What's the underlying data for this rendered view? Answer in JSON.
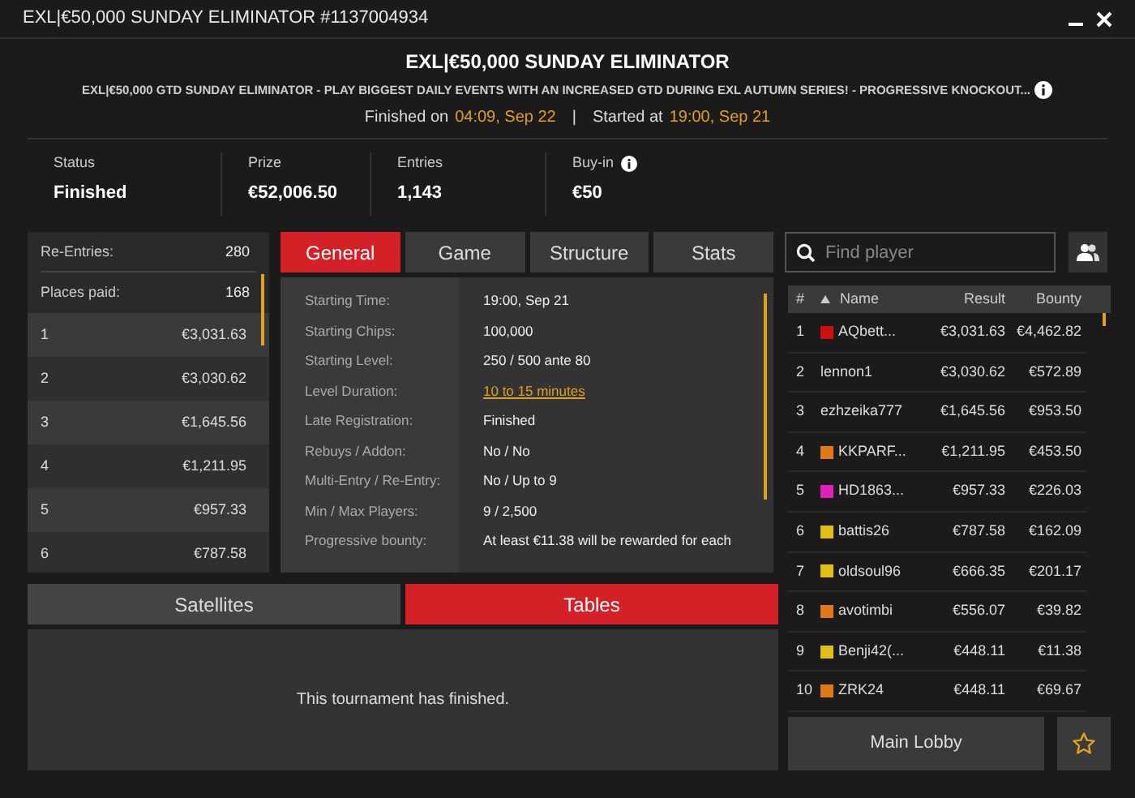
{
  "window": {
    "title": "EXL|€50,000 SUNDAY ELIMINATOR #1137004934"
  },
  "header": {
    "title": "EXL|€50,000 SUNDAY ELIMINATOR",
    "description": "EXL|€50,000 GTD SUNDAY ELIMINATOR - PLAY BIGGEST DAILY EVENTS WITH AN INCREASED GTD DURING EXL AUTUMN SERIES! - PROGRESSIVE KNOCKOUT...",
    "finished_label": "Finished on",
    "finished_time": "04:09, Sep 22",
    "separator": "|",
    "started_label": "Started at",
    "started_time": "19:00, Sep 21"
  },
  "stats": [
    {
      "label": "Status",
      "value": "Finished",
      "info": false
    },
    {
      "label": "Prize",
      "value": "€52,006.50",
      "info": false
    },
    {
      "label": "Entries",
      "value": "1,143",
      "info": false
    },
    {
      "label": "Buy-in",
      "value": "€50",
      "info": true
    }
  ],
  "summary": [
    {
      "label": "Re-Entries:",
      "value": "280"
    },
    {
      "label": "Places paid:",
      "value": "168"
    }
  ],
  "payouts": [
    {
      "place": "1",
      "amount": "€3,031.63"
    },
    {
      "place": "2",
      "amount": "€3,030.62"
    },
    {
      "place": "3",
      "amount": "€1,645.56"
    },
    {
      "place": "4",
      "amount": "€1,211.95"
    },
    {
      "place": "5",
      "amount": "€957.33"
    },
    {
      "place": "6",
      "amount": "€787.58"
    }
  ],
  "tabs": [
    {
      "label": "General",
      "selected": true
    },
    {
      "label": "Game",
      "selected": false
    },
    {
      "label": "Structure",
      "selected": false
    },
    {
      "label": "Stats",
      "selected": false
    }
  ],
  "details": [
    {
      "label": "Starting Time:",
      "value": "19:00, Sep 21",
      "kind": "text"
    },
    {
      "label": "Starting Chips:",
      "value": "100,000",
      "kind": "text"
    },
    {
      "label": "Starting Level:",
      "value": "250 / 500 ante 80",
      "kind": "text"
    },
    {
      "label": "Level Duration:",
      "value": "10 to 15 minutes",
      "kind": "link"
    },
    {
      "label": "Late Registration:",
      "value": "Finished",
      "kind": "text"
    },
    {
      "label": "Rebuys / Addon:",
      "value": "No / No",
      "kind": "text"
    },
    {
      "label": "Multi-Entry / Re-Entry:",
      "value": "No / Up to 9",
      "kind": "text"
    },
    {
      "label": "Min / Max Players:",
      "value": "9 / 2,500",
      "kind": "text"
    },
    {
      "label": "Progressive bounty:",
      "value": "At least €11.38 will be rewarded for each",
      "kind": "text"
    }
  ],
  "bottom_tabs": [
    {
      "label": "Satellites",
      "selected": false
    },
    {
      "label": "Tables",
      "selected": true
    }
  ],
  "bottom_message": "This tournament has finished.",
  "search": {
    "placeholder": "Find player"
  },
  "players": {
    "columns": [
      "#",
      "Name",
      "Result",
      "Bounty"
    ],
    "rows": [
      {
        "rank": "1",
        "name": "AQbett...",
        "result": "€3,031.63",
        "bounty": "€4,462.82",
        "color": "#cc1010"
      },
      {
        "rank": "2",
        "name": "lennon1",
        "result": "€3,030.62",
        "bounty": "€572.89"
      },
      {
        "rank": "3",
        "name": "ezhzeika777",
        "result": "€1,645.56",
        "bounty": "€953.50"
      },
      {
        "rank": "4",
        "name": "KKPARF...",
        "result": "€1,211.95",
        "bounty": "€453.50",
        "color": "#e07818"
      },
      {
        "rank": "5",
        "name": "HD1863...",
        "result": "€957.33",
        "bounty": "€226.03",
        "color": "#e020b8"
      },
      {
        "rank": "6",
        "name": "battis26",
        "result": "€787.58",
        "bounty": "€162.09",
        "color": "#e0c018"
      },
      {
        "rank": "7",
        "name": "oldsoul96",
        "result": "€666.35",
        "bounty": "€201.17",
        "color": "#e0c018"
      },
      {
        "rank": "8",
        "name": "avotimbi",
        "result": "€556.07",
        "bounty": "€39.82",
        "color": "#e07818"
      },
      {
        "rank": "9",
        "name": "Benji42(...",
        "result": "€448.11",
        "bounty": "€11.38",
        "color": "#e0c018"
      },
      {
        "rank": "10",
        "name": "ZRK24",
        "result": "€448.11",
        "bounty": "€69.67",
        "color": "#e07818"
      }
    ]
  },
  "main_lobby_button": "Main Lobby"
}
